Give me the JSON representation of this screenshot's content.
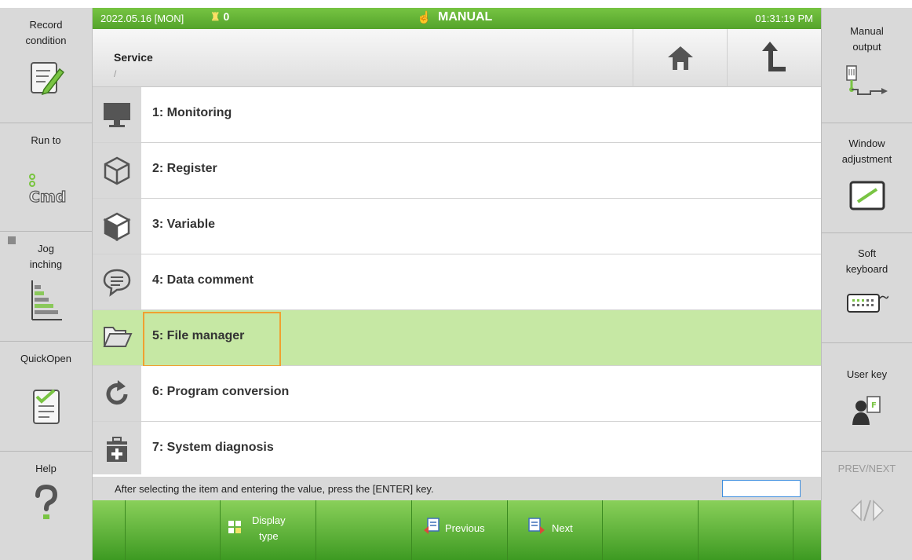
{
  "status_bar": {
    "date": "2022.05.16 [MON]",
    "alarm_count": "0",
    "mode": "MANUAL",
    "time": "01:31:19 PM"
  },
  "header": {
    "title": "Service",
    "path": "/"
  },
  "menu": {
    "items": [
      {
        "label": "1: Monitoring",
        "icon": "monitor-icon"
      },
      {
        "label": "2: Register",
        "icon": "cube-outline-icon"
      },
      {
        "label": "3: Variable",
        "icon": "cube-icon"
      },
      {
        "label": "4: Data comment",
        "icon": "speech-bubble-icon"
      },
      {
        "label": "5: File manager",
        "icon": "folder-icon"
      },
      {
        "label": "6: Program conversion",
        "icon": "refresh-icon"
      },
      {
        "label": "7: System diagnosis",
        "icon": "medical-kit-icon"
      }
    ],
    "selected_index": 4
  },
  "footer": {
    "message": "After selecting the item and entering the value, press the [ENTER] key.",
    "input_value": ""
  },
  "left_panel": {
    "record_condition": "Record\ncondition",
    "run_to": "Run to",
    "jog_inching": "Jog\ninching",
    "quickopen": "QuickOpen",
    "help": "Help"
  },
  "right_panel": {
    "manual_output": "Manual\noutput",
    "window_adjustment": "Window\nadjustment",
    "soft_keyboard": "Soft\nkeyboard",
    "user_key": "User key",
    "prev_next": "PREV/NEXT"
  },
  "function_keys": {
    "display_type": "Display\ntype",
    "previous": "Previous",
    "next": "Next"
  },
  "colors": {
    "accent_green": "#5aab30",
    "selected_row": "#c6e8a4",
    "focus_border": "#f0a030"
  }
}
